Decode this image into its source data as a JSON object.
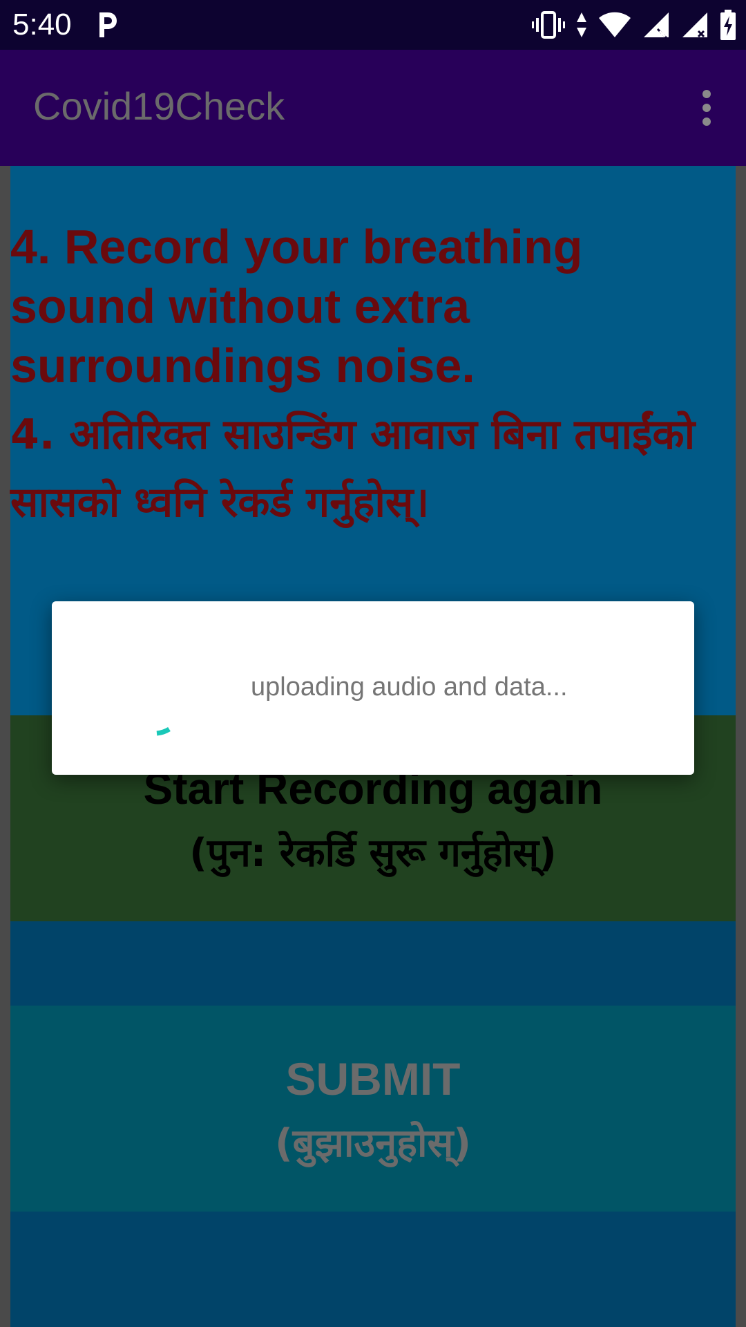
{
  "status_bar": {
    "time": "5:40",
    "icons": [
      "parking-icon",
      "vibrate-icon",
      "data-arrows-icon",
      "wifi-icon",
      "signal-x-icon",
      "signal-x-icon-2",
      "battery-charging-icon"
    ]
  },
  "app_bar": {
    "title": "Covid19Check",
    "overflow_icon": "more-vert-icon"
  },
  "instruction": {
    "english": "4. Record your breathing sound without extra surroundings noise.",
    "nepali": "4. अतिरिक्त साउन्डिंग आवाज बिना तपाईंको सासको ध्वनि रेकर्ड गर्नुहोस्।"
  },
  "buttons": {
    "record_again": {
      "label": "Start Recording again",
      "label_ne": "(पुन: रेकर्डि सुरू गर्नुहोस्)"
    },
    "submit": {
      "label": "SUBMIT",
      "label_ne": "(बुझाउनुहोस्)"
    }
  },
  "dialog": {
    "message": "uploading audio and data...",
    "spinner_color": "#1ac8b8"
  },
  "colors": {
    "status_bar": "#0d0330",
    "app_bar": "#280059",
    "content_bg": "#015a87",
    "instruction_text": "#6a0a0d",
    "record_button": "#214220",
    "submit_button": "#015566"
  }
}
